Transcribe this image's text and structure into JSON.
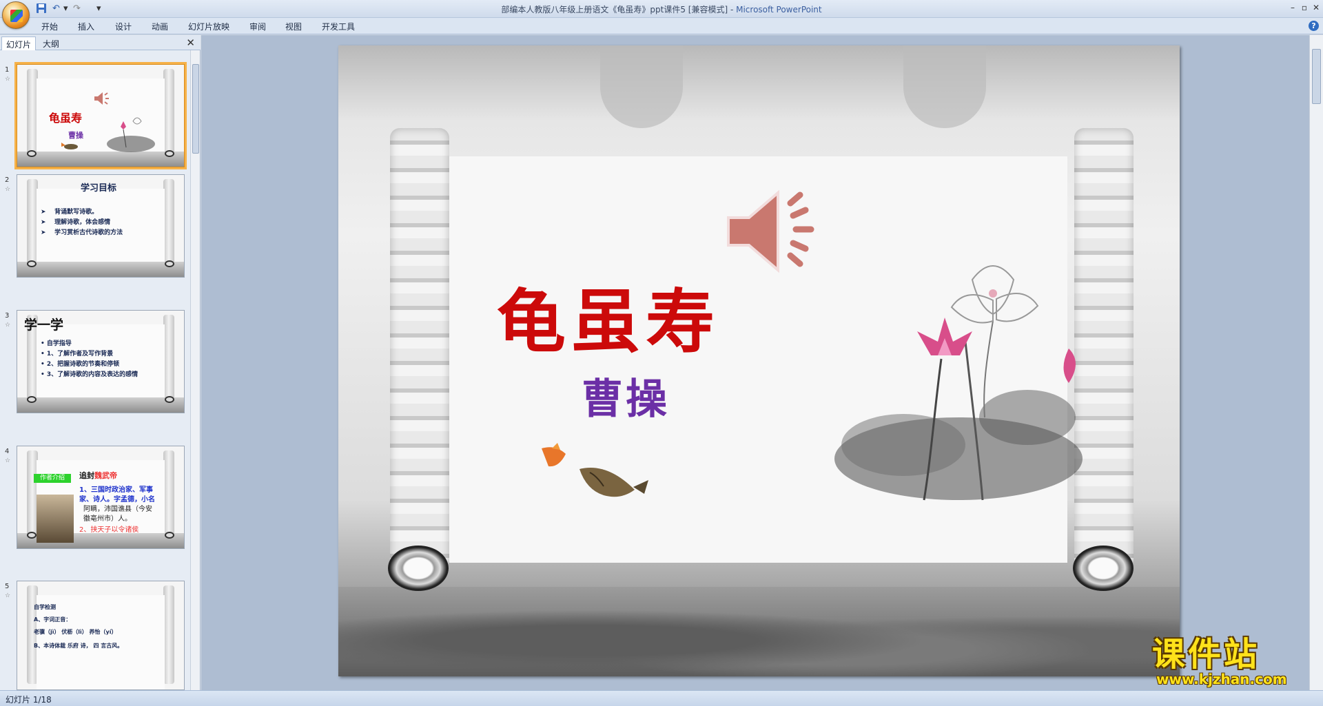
{
  "window": {
    "title": "部编本人教版八年级上册语文《龟虽寿》ppt课件5 [兼容模式] - ",
    "app_name": "Microsoft PowerPoint",
    "controls": {
      "minimize": "–",
      "restore": "▫",
      "close": "✕"
    }
  },
  "qat": {
    "undo": "↶",
    "redo": "↷",
    "dropdown": "▾"
  },
  "ribbon": {
    "tabs": [
      "开始",
      "插入",
      "设计",
      "动画",
      "幻灯片放映",
      "审阅",
      "视图",
      "开发工具"
    ],
    "help": "?"
  },
  "left_pane": {
    "tabs": [
      "幻灯片",
      "大纲"
    ],
    "close": "✕",
    "thumbnails": [
      {
        "num": "1",
        "title": "龟虽寿",
        "author": "曹操"
      },
      {
        "num": "2",
        "title": "学习目标",
        "lines": [
          "背诵默写诗歌。",
          "理解诗歌，体会感情",
          "学习赏析古代诗歌的方法"
        ]
      },
      {
        "num": "3",
        "title": "学一学",
        "lines": [
          "• 自学指导",
          "• 1、了解作者及写作背景",
          "• 2、把握诗歌的节奏和停顿",
          "• 3、了解诗歌的内容及表达的感情"
        ]
      },
      {
        "num": "4",
        "badge": "作者介绍",
        "title_prefix": "追封",
        "title_red": "魏武帝",
        "lines": [
          "1、三国时政治家、军事",
          "家、诗人。字孟德，小名",
          "阿瞒，沛国谯县（今安",
          "徽亳州市）人。",
          "2、挟天子以令诸侯"
        ]
      },
      {
        "num": "5",
        "lines": [
          "自学检测",
          "A、字词正音：",
          "老骥（jì）  伏枥（lì）  养怡（yí）",
          "B、本诗体裁  乐府  诗，  四  言古风。"
        ]
      }
    ]
  },
  "slide": {
    "title": "龟虽寿",
    "author": "曹操"
  },
  "watermark": {
    "main": "课件站",
    "url": "www.kjzhan.com"
  },
  "status": {
    "text": "幻灯片 1/18"
  },
  "colors": {
    "title": "#cc0a0a",
    "author": "#6b2fa6",
    "selection": "#f6b24a"
  }
}
